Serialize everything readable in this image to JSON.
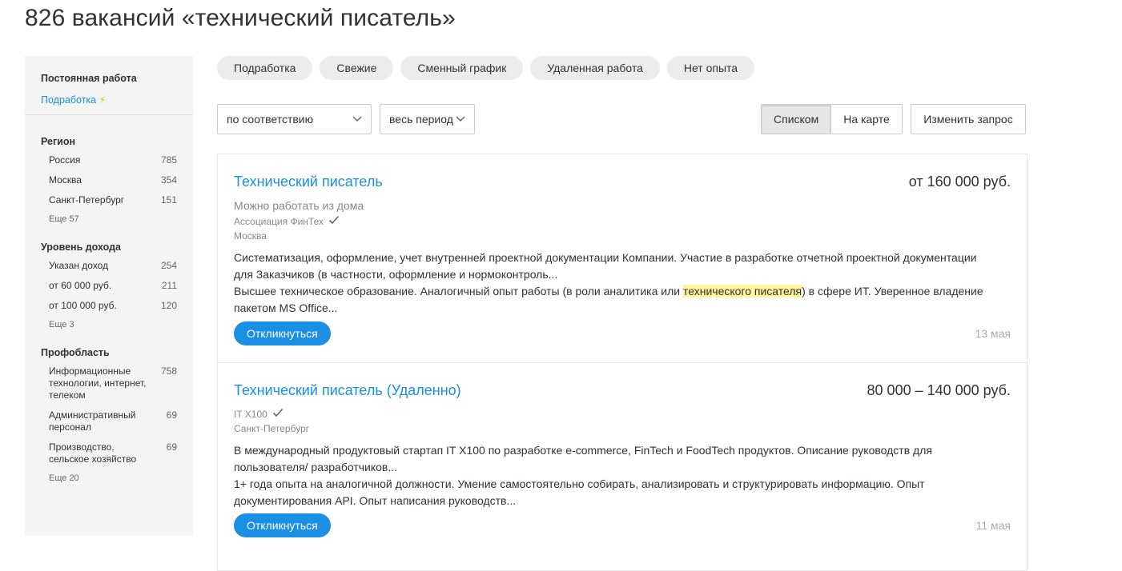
{
  "page": {
    "title": "826 вакансий «технический писатель»"
  },
  "sidebar": {
    "employment_label": "Постоянная работа",
    "parttime_link": "Подработка",
    "groups": [
      {
        "title": "Регион",
        "items": [
          {
            "label": "Россия",
            "count": "785"
          },
          {
            "label": "Москва",
            "count": "354"
          },
          {
            "label": "Санкт-Петербург",
            "count": "151"
          }
        ],
        "more": "Еще 57"
      },
      {
        "title": "Уровень дохода",
        "items": [
          {
            "label": "Указан доход",
            "count": "254"
          },
          {
            "label": "от 60 000 руб.",
            "count": "211"
          },
          {
            "label": "от 100 000 руб.",
            "count": "120"
          }
        ],
        "more": "Еще 3"
      },
      {
        "title": "Профобласть",
        "items": [
          {
            "label": "Информационные технологии, интернет, телеком",
            "count": "758"
          },
          {
            "label": "Административный персонал",
            "count": "69"
          },
          {
            "label": "Производство, сельское хозяйство",
            "count": "69"
          }
        ],
        "more": "Еще 20"
      }
    ]
  },
  "chips": [
    "Подработка",
    "Свежие",
    "Сменный график",
    "Удаленная работа",
    "Нет опыта"
  ],
  "controls": {
    "sort_value": "по соответствию",
    "period_value": "весь период",
    "view_list": "Списком",
    "view_map": "На карте",
    "edit_query": "Изменить запрос"
  },
  "vacancies": [
    {
      "title": "Технический писатель",
      "salary": "от 160 000 руб.",
      "remote": "Можно работать из дома",
      "company": "Ассоциация ФинТех",
      "city": "Москва",
      "resp": "Систематизация, оформление, учет внутренней проектной документации Компании. Участие в разработке отчетной проектной документации для Заказчиков (в частности, оформление и нормоконтроль...",
      "req_before": "Высшее техническое образование. Аналогичный опыт работы (в роли аналитика или ",
      "req_highlight": "технического писателя",
      "req_after": ") в сфере ИТ. Уверенное владение пакетом MS Office...",
      "apply": "Откликнуться",
      "date": "13 мая"
    },
    {
      "title": "Технический писатель (Удаленно)",
      "salary": "80 000 – 140 000 руб.",
      "company": "IT X100",
      "city": "Санкт-Петербург",
      "resp": "В международный продуктовый стартап IT X100 по разработке e-commerce, FinTech и FoodTech продуктов. Описание руководств для пользователя/ разработчиков...",
      "req": "1+ года опыта на аналогичной должности. Умение самостоятельно собирать, анализировать и структурировать информацию. Опыт документирования API. Опыт написания руководств...",
      "apply": "Откликнуться",
      "date": "11 мая"
    }
  ]
}
